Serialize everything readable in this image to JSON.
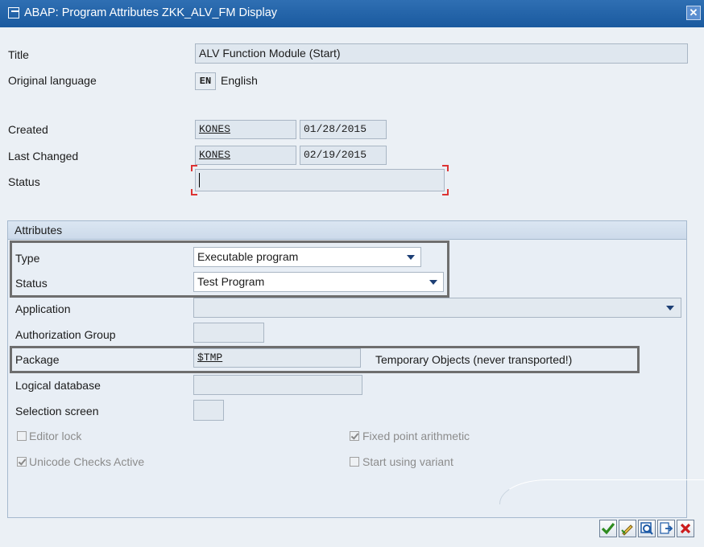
{
  "window": {
    "title": "ABAP: Program Attributes ZKK_ALV_FM Display",
    "close_label": "✕"
  },
  "header": {
    "title_label": "Title",
    "title_value": "ALV Function Module (Start)",
    "orig_lang_label": "Original language",
    "orig_lang_code": "EN",
    "orig_lang_name": "English",
    "created_label": "Created",
    "created_user": "KONES",
    "created_date": "01/28/2015",
    "changed_label": "Last Changed",
    "changed_user": "KONES",
    "changed_date": "02/19/2015",
    "status_label": "Status",
    "status_value": ""
  },
  "attributes": {
    "title": "Attributes",
    "type_label": "Type",
    "type_value": "Executable program",
    "status_label": "Status",
    "status_value": "Test Program",
    "application_label": "Application",
    "application_value": "",
    "auth_group_label": "Authorization Group",
    "auth_group_value": "",
    "package_label": "Package",
    "package_value": "$TMP",
    "package_desc": "Temporary Objects (never transported!)",
    "logical_db_label": "Logical database",
    "logical_db_value": "",
    "selection_screen_label": "Selection screen",
    "selection_screen_value": "",
    "checkboxes": [
      {
        "label": "Editor lock",
        "checked": false
      },
      {
        "label": "Fixed point arithmetic",
        "checked": true
      },
      {
        "label": "Unicode Checks Active",
        "checked": true
      },
      {
        "label": "Start using variant",
        "checked": false
      }
    ]
  },
  "toolbar": {
    "buttons": [
      "check-icon",
      "edit-icon",
      "display-icon",
      "navigate-icon",
      "cancel-icon"
    ],
    "colors": {
      "check": "#2e8b1f",
      "cancel": "#cc1b1b",
      "accent": "#1d5aa6"
    }
  }
}
